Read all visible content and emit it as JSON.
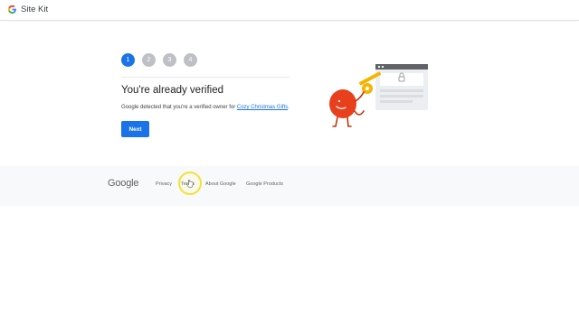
{
  "header": {
    "app_name": "Site Kit",
    "logo_icon": "google-g-icon"
  },
  "steps": {
    "items": [
      "1",
      "2",
      "3",
      "4"
    ],
    "active_index": 0
  },
  "main": {
    "title": "You're already verified",
    "description_prefix": "Google detected that you're a verified owner for ",
    "site_link": "Cozy Christmas Gifts",
    "description_suffix": ".",
    "next_label": "Next"
  },
  "illustration": {
    "name": "verified-key-character-illustration"
  },
  "footer": {
    "logo_text": "Google",
    "links": [
      "Privacy",
      "Terms",
      "About Google",
      "Google Products"
    ]
  },
  "colors": {
    "accent": "#1a73e8",
    "inactive_step": "#bdc1c6",
    "footer_bg": "#f8f9fa",
    "character": "#e8401c",
    "key": "#f6b400"
  }
}
